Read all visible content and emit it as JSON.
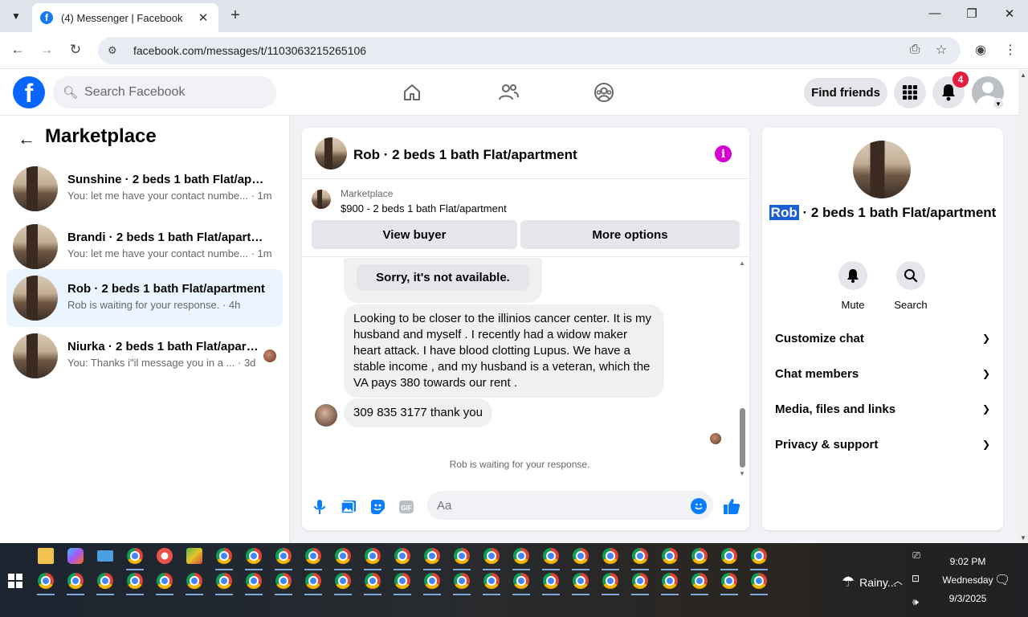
{
  "browser": {
    "tab_title": "(4) Messenger | Facebook",
    "tab_favicon": "f",
    "url": "facebook.com/messages/t/1103063215265106",
    "new_tab": "+",
    "minimize": "—",
    "restore": "❐",
    "close": "✕"
  },
  "fb": {
    "logo": "f",
    "search_placeholder": "Search Facebook",
    "find_friends": "Find friends",
    "notification_count": "4"
  },
  "sidebar": {
    "title": "Marketplace",
    "conversations": [
      {
        "name": "Sunshine · 2 beds 1 bath Flat/apartment",
        "snippet": "You: let me have your contact numbe... · 1m",
        "active": false
      },
      {
        "name": "Brandi · 2 beds 1 bath Flat/apartment",
        "snippet": "You: let me have your contact numbe... · 1m",
        "active": false
      },
      {
        "name": "Rob · 2 beds 1 bath Flat/apartment",
        "snippet": "Rob is waiting for your response. · 4h",
        "active": true
      },
      {
        "name": "Niurka · 2 beds 1 bath Flat/apartment",
        "snippet": "You: Thanks i\"il message you in a ... · 3d",
        "active": false
      }
    ]
  },
  "chat": {
    "title": "Rob · 2 beds 1 bath Flat/apartment",
    "info_icon": "i",
    "marketplace_label": "Marketplace",
    "listing": "$900 - 2 beds 1 bath Flat/apartment",
    "view_buyer": "View buyer",
    "more_options": "More options",
    "sorry_label": "Sorry, it's not available.",
    "message_long": "Looking to be closer to the illinios cancer center.  It is my husband and myself  . I recently had a widow maker heart attack.  I have blood clotting Lupus.  We have a stable income  , and my husband is a veteran,  which the VA pays 380 towards our rent .",
    "message_phone": "309 835 3177  thank you",
    "waiting": "Rob is waiting for your response.",
    "composer_placeholder": "Aa"
  },
  "right_panel": {
    "title_name": "Rob",
    "title_rest": " · 2 beds 1 bath Flat/apartment",
    "mute": "Mute",
    "search": "Search",
    "sections": [
      "Customize chat",
      "Chat members",
      "Media, files and links",
      "Privacy & support"
    ]
  },
  "taskbar": {
    "weather": "Rainy...",
    "time": "9:02 PM",
    "day": "Wednesday",
    "date": "9/3/2025"
  }
}
